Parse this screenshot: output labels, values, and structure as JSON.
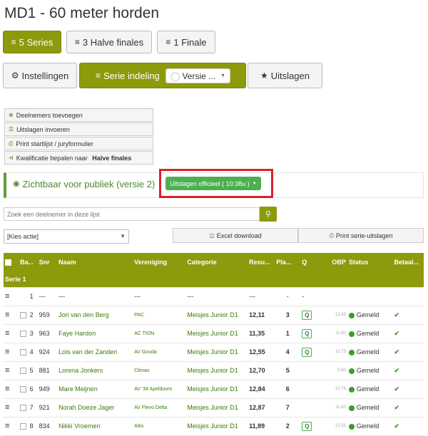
{
  "title": "MD1 - 60 meter horden",
  "round_tabs": [
    {
      "label": "5 Series",
      "active": true
    },
    {
      "label": "3 Halve finales",
      "active": false
    },
    {
      "label": "1 Finale",
      "active": false
    }
  ],
  "section_tabs": {
    "settings": "Instellingen",
    "series_layout": "Serie indeling",
    "version_select": "Versie ...",
    "results": "Uitslagen"
  },
  "actions": {
    "add_participants": "Deelnemers toevoegen",
    "enter_results": "Uitslagen invoeren",
    "print_start": "Print startlijst / juryformulier",
    "qualify_prefix": "Kwalificatie bepalen naar ",
    "qualify_target": "Halve finales"
  },
  "visibility": {
    "label": "Zichtbaar voor publiek (versie 2)",
    "status": "Uitslagen officieel ( 10:38u )"
  },
  "search": {
    "placeholder": "Zoek een deelnemer in deze lijst"
  },
  "bulk_action": {
    "selected": "[Kies actie]"
  },
  "excel_button": "Excel download",
  "print_series_button": "Print serie-uitslagen",
  "table": {
    "columns": [
      "Ba...",
      "Snr",
      "Naam",
      "Vereniging",
      "Categorie",
      "Resu...",
      "Pla...",
      "Q",
      "OBP",
      "Status",
      "Betaal..."
    ],
    "group_label": "Serie 1",
    "empty_row": {
      "lane": "1",
      "snr": "---",
      "name": "---",
      "club": "---",
      "category": "---",
      "result": "---",
      "place": "-",
      "q": "-"
    },
    "rows": [
      {
        "lane": "2",
        "snr": "959",
        "name": "Jori van den Berg",
        "club": "PAC",
        "category": "Meisjes Junior D1",
        "result": "12,11",
        "place": "3",
        "q": "Q",
        "obp": "12,89",
        "status": "Gemeld"
      },
      {
        "lane": "3",
        "snr": "963",
        "name": "Faye Hardon",
        "club": "AC TION",
        "category": "Meisjes Junior D1",
        "result": "11,35",
        "place": "1",
        "q": "Q",
        "obp": "11,60",
        "status": "Gemeld"
      },
      {
        "lane": "4",
        "snr": "924",
        "name": "Lois van der Zanden",
        "club": "AV Gouda",
        "category": "Meisjes Junior D1",
        "result": "12,55",
        "place": "4",
        "q": "Q",
        "obp": "10,75",
        "status": "Gemeld"
      },
      {
        "lane": "5",
        "snr": "881",
        "name": "Lorena Jonkers",
        "club": "Climax",
        "category": "Meisjes Junior D1",
        "result": "12,70",
        "place": "5",
        "q": "",
        "obp": "9,40",
        "status": "Gemeld"
      },
      {
        "lane": "6",
        "snr": "949",
        "name": "Mare Meijnen",
        "club": "AV '34 Apeldoorn",
        "category": "Meisjes Junior D1",
        "result": "12,84",
        "place": "6",
        "q": "",
        "obp": "10,76",
        "status": "Gemeld"
      },
      {
        "lane": "7",
        "snr": "921",
        "name": "Norah Doeze Jager",
        "club": "AV Flevo Delta",
        "category": "Meisjes Junior D1",
        "result": "12,87",
        "place": "7",
        "q": "",
        "obp": "11,80",
        "status": "Gemeld"
      },
      {
        "lane": "8",
        "snr": "834",
        "name": "Nikki Vroemen",
        "club": "Altis",
        "category": "Meisjes Junior D1",
        "result": "11,89",
        "place": "2",
        "q": "Q",
        "obp": "12,55",
        "status": "Gemeld"
      }
    ]
  },
  "colors": {
    "primary": "#8c9a0b",
    "status_green": "#4caf50",
    "highlight_red": "#d9202e"
  },
  "icons": [
    "podium-icon",
    "gear-icon",
    "eye-icon",
    "trophy-icon",
    "plus-circle-icon",
    "list-icon",
    "print-icon",
    "share-icon",
    "search-icon",
    "excel-icon",
    "burger-icon",
    "check-icon"
  ]
}
